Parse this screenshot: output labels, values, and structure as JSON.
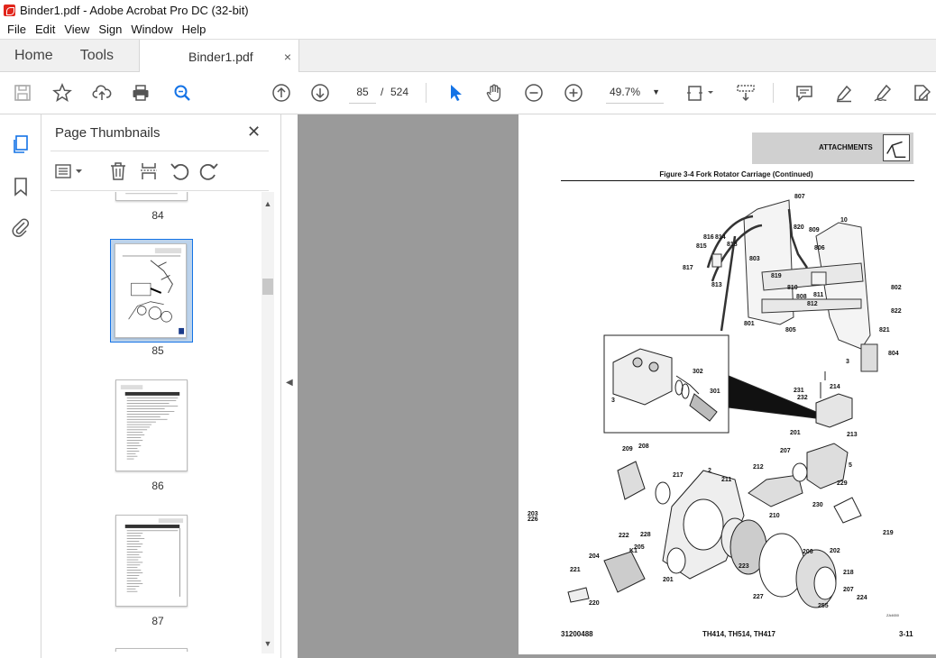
{
  "window": {
    "title": "Binder1.pdf - Adobe Acrobat Pro DC (32-bit)"
  },
  "menu": [
    "File",
    "Edit",
    "View",
    "Sign",
    "Window",
    "Help"
  ],
  "tabs": {
    "home": "Home",
    "tools": "Tools",
    "document": "Binder1.pdf",
    "close": "×"
  },
  "toolbar": {
    "current_page": "85",
    "page_sep": "/",
    "total_pages": "524",
    "zoom": "49.7%"
  },
  "panel": {
    "title": "Page Thumbnails",
    "close": "✕",
    "thumbnails": [
      {
        "label": "84"
      },
      {
        "label": "85"
      },
      {
        "label": "86"
      },
      {
        "label": "87"
      }
    ]
  },
  "document": {
    "header": "ATTACHMENTS",
    "figure_title": "Figure 3-4 Fork Rotator Carriage (Continued)",
    "footer_left": "31200488",
    "footer_center": "TH414, TH514, TH417",
    "footer_right": "3-11",
    "drawing_code": "ZA4650",
    "callouts": [
      "807",
      "820",
      "809",
      "10",
      "816",
      "814",
      "815",
      "818",
      "806",
      "803",
      "817",
      "819",
      "813",
      "810",
      "811",
      "808",
      "812",
      "802",
      "822",
      "801",
      "805",
      "821",
      "804",
      "302",
      "301",
      "3",
      "214",
      "231",
      "232",
      "3",
      "201",
      "213",
      "209",
      "208",
      "207",
      "217",
      "2",
      "211",
      "212",
      "5",
      "229",
      "230",
      "228",
      "210",
      "219",
      "222",
      "K1",
      "205",
      "204",
      "206",
      "202",
      "221",
      "223",
      "201",
      "218",
      "207",
      "227",
      "224",
      "220",
      "255",
      "203",
      "226"
    ]
  },
  "colors": {
    "accent_blue": "#1473e6",
    "viewer_bg": "#9a9a9a",
    "header_gray": "#d0d0d0"
  }
}
